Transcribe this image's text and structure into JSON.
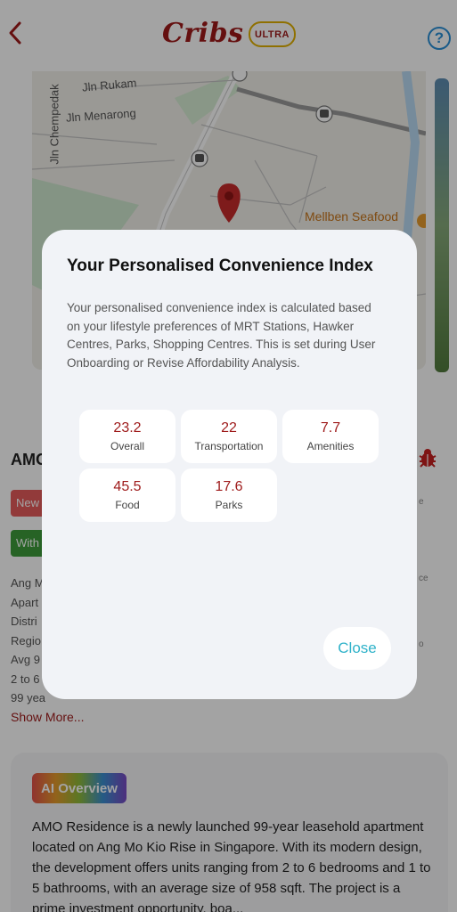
{
  "header": {
    "logo": "Cribs",
    "badge": "ULTRA",
    "help": "?"
  },
  "map": {
    "streets": [
      "Jln Rukam",
      "Jln Menarong",
      "Jln Chempedak"
    ],
    "poi": "Mellben Seafood"
  },
  "project": {
    "title": "AMO",
    "tags": [
      "New",
      "With"
    ],
    "detail_lines": [
      "Ang M",
      "Apart",
      "Distri",
      "Regio",
      "Avg 9",
      "2 to 6",
      "99 yea"
    ],
    "side_cards": [
      "e",
      "ce",
      "o"
    ]
  },
  "show_more": "Show More...",
  "ai_overview": {
    "badge": "AI Overview",
    "text": "AMO Residence is a newly launched 99-year leasehold apartment located on Ang Mo Kio Rise in Singapore. With its modern design, the development offers units ranging from 2 to 6 bedrooms and 1 to 5 bathrooms, with an average size of 958 sqft. The project is a prime investment opportunity, boa..."
  },
  "modal": {
    "title": "Your Personalised Convenience Index",
    "description": "Your personalised convenience index is calculated based on your lifestyle preferences of MRT Stations, Hawker Centres, Parks, Shopping Centres. This is set during User Onboarding or Revise Affordability Analysis.",
    "metrics": [
      {
        "value": "23.2",
        "label": "Overall"
      },
      {
        "value": "22",
        "label": "Transportation"
      },
      {
        "value": "7.7",
        "label": "Amenities"
      },
      {
        "value": "45.5",
        "label": "Food"
      },
      {
        "value": "17.6",
        "label": "Parks"
      }
    ],
    "close_label": "Close"
  },
  "colors": {
    "brand": "#9e1a1a",
    "ultra_border": "#e0b000",
    "close": "#2fb2c9"
  }
}
